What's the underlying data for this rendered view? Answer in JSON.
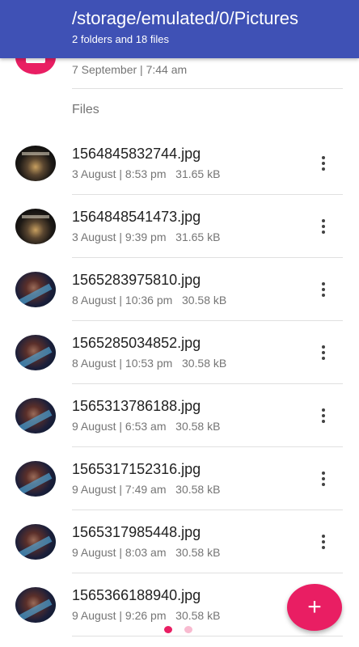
{
  "header": {
    "title": "/storage/emulated/0/Pictures",
    "subtitle": "2 folders and 18 files",
    "background_color": "#3f51b5"
  },
  "folder_partial": {
    "meta": "7 September | 7:44 am",
    "icon": "folder-icon",
    "icon_color": "#e91e63"
  },
  "sections": {
    "files_label": "Files"
  },
  "files": [
    {
      "name": "1564845832744.jpg",
      "date": "3 August | 8:53 pm",
      "size": "31.65 kB",
      "thumb": "shield"
    },
    {
      "name": "1564848541473.jpg",
      "date": "3 August | 9:39 pm",
      "size": "31.65 kB",
      "thumb": "shield"
    },
    {
      "name": "1565283975810.jpg",
      "date": "8 August | 10:36 pm",
      "size": "30.58 kB",
      "thumb": "face"
    },
    {
      "name": "1565285034852.jpg",
      "date": "8 August | 10:53 pm",
      "size": "30.58 kB",
      "thumb": "face"
    },
    {
      "name": "1565313786188.jpg",
      "date": "9 August | 6:53 am",
      "size": "30.58 kB",
      "thumb": "face"
    },
    {
      "name": "1565317152316.jpg",
      "date": "9 August | 7:49 am",
      "size": "30.58 kB",
      "thumb": "face"
    },
    {
      "name": "1565317985448.jpg",
      "date": "9 August | 8:03 am",
      "size": "30.58 kB",
      "thumb": "face"
    },
    {
      "name": "1565366188940.jpg",
      "date": "9 August | 9:26 pm",
      "size": "30.58 kB",
      "thumb": "face"
    }
  ],
  "fab": {
    "label": "+",
    "icon": "add-icon",
    "color": "#e91e63"
  },
  "pager": {
    "current_page": 1,
    "total_pages": 2
  }
}
